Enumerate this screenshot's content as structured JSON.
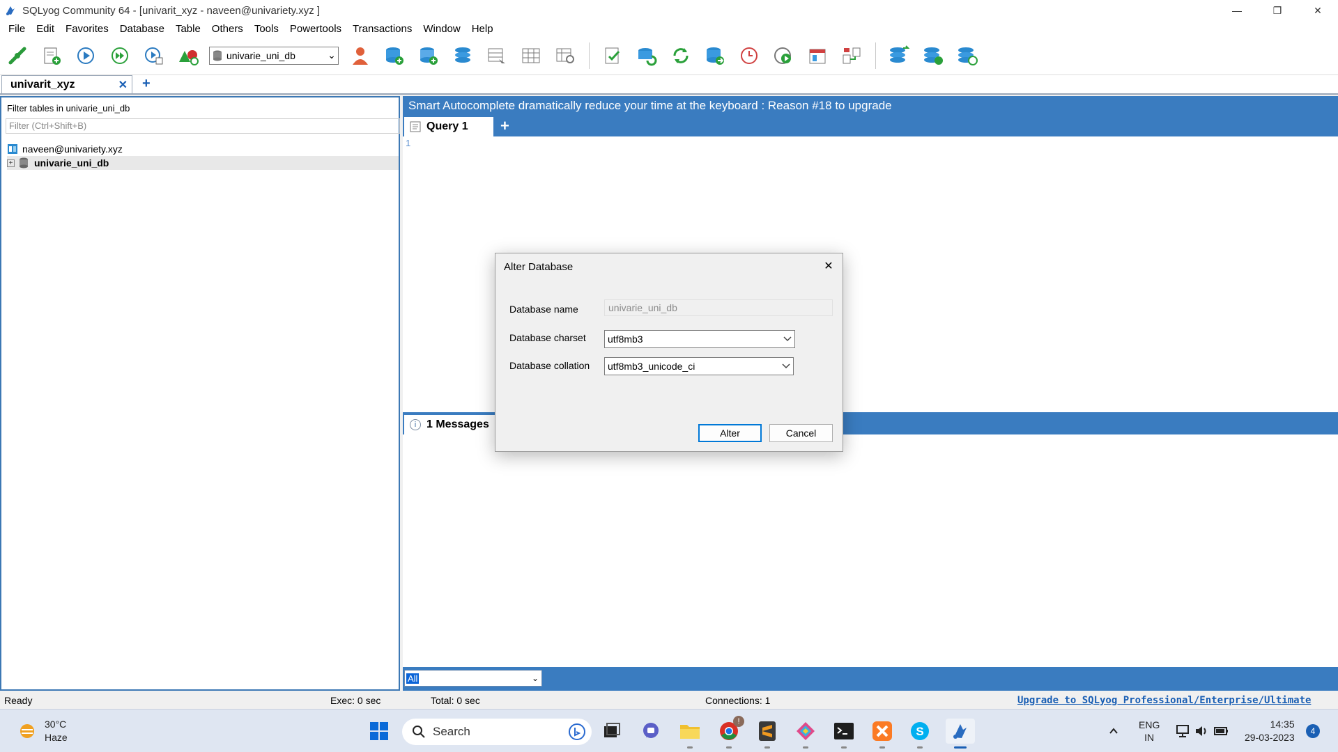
{
  "window": {
    "title": "SQLyog Community 64 - [univarit_xyz - naveen@univariety.xyz ]",
    "minimize": "—",
    "restore": "❐",
    "close": "✕"
  },
  "menu": [
    "File",
    "Edit",
    "Favorites",
    "Database",
    "Table",
    "Others",
    "Tools",
    "Powertools",
    "Transactions",
    "Window",
    "Help"
  ],
  "toolbar": {
    "db_selector_value": "univarie_uni_db"
  },
  "connection_tab": {
    "label": "univarit_xyz",
    "close": "✕",
    "add": "+"
  },
  "object_browser": {
    "filter_label": "Filter tables in univarie_uni_db",
    "filter_placeholder": "Filter (Ctrl+Shift+B)",
    "connection": "naveen@univariety.xyz",
    "database": "univarie_uni_db",
    "expander": "+"
  },
  "banner": {
    "text": "Smart Autocomplete dramatically reduce your time at the keyboard : Reason #18 to upgrade"
  },
  "query_tab": {
    "label": "Query 1",
    "add": "+",
    "line_number": "1"
  },
  "messages_tab": {
    "label": "1 Messages",
    "info": "i"
  },
  "result_filter": {
    "value": "All"
  },
  "status": {
    "ready": "Ready",
    "exec": "Exec: 0 sec",
    "total": "Total: 0 sec",
    "connections": "Connections: 1",
    "upgrade": "Upgrade to SQLyog Professional/Enterprise/Ultimate"
  },
  "dialog": {
    "title": "Alter Database",
    "close": "✕",
    "db_name_label": "Database name",
    "db_name_value": "univarie_uni_db",
    "charset_label": "Database charset",
    "charset_value": "utf8mb3",
    "collation_label": "Database collation",
    "collation_value": "utf8mb3_unicode_ci",
    "alter_button": "Alter",
    "cancel_button": "Cancel"
  },
  "taskbar": {
    "temperature": "30°C",
    "weather": "Haze",
    "search_label": "Search",
    "chrome_badge": "!",
    "language_top": "ENG",
    "language_bottom": "IN",
    "time": "14:35",
    "date": "29-03-2023",
    "notifications": "4"
  },
  "colors": {
    "accent_blue": "#3a7cc0",
    "link_blue": "#1a5fb4"
  }
}
